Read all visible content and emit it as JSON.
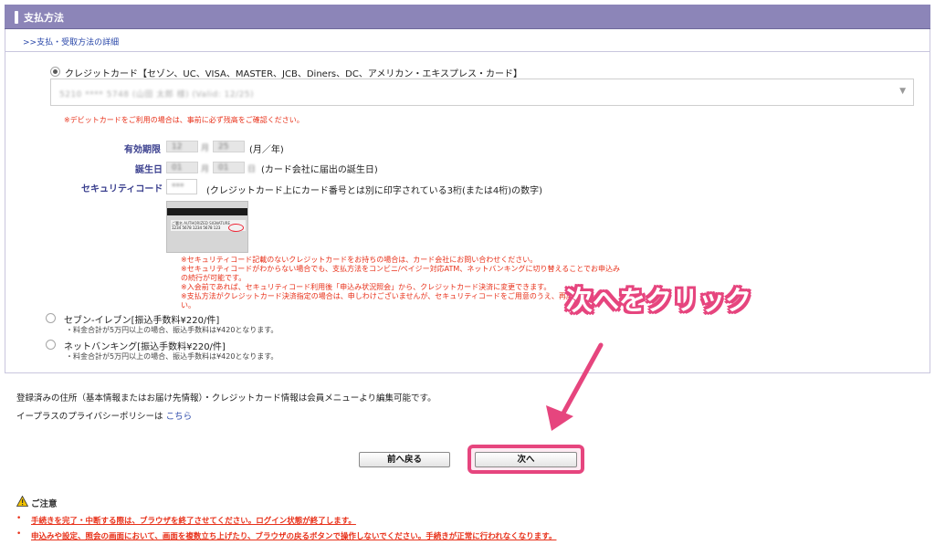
{
  "header": {
    "title": "支払方法"
  },
  "detail_link": ">>支払・受取方法の詳細",
  "credit": {
    "label": "クレジットカード【セゾン、UC、VISA、MASTER、JCB、Diners、DC、アメリカン・エキスプレス・カード】",
    "select_value": "5210 **** 5748 (山田 太郎 様) (Valid: 12/25)",
    "debit_note": "※デビットカードをご利用の場合は、事前に必ず残高をご確認ください。",
    "expiry_label": "有効期限",
    "expiry_month": "12",
    "expiry_month_unit": "月",
    "expiry_year": "25",
    "expiry_year_unit": "年",
    "expiry_note": "(月／年)",
    "birth_label": "誕生日",
    "birth_month": "01",
    "birth_month_unit": "月",
    "birth_day": "01",
    "birth_day_unit": "日",
    "birth_note": "(カード会社に届出の誕生日)",
    "security_label": "セキュリティコード",
    "security_value": "***",
    "security_note": "(クレジットカード上にカード番号とは別に印字されている3桁(または4桁)の数字)",
    "card_sig_text": "ご署名 AUTHORIZED SIGNATURE",
    "card_num_text": "1234 5678 1234 5678 123",
    "security_notes": [
      "※セキュリティコード記載のないクレジットカードをお持ちの場合は、カード会社にお問い合わせください。",
      "※セキュリティコードがわからない場合でも、支払方法をコンビニ/ペイジー対応ATM、ネットバンキングに切り替えることでお申込み",
      "の続行が可能です。",
      "※入会前であれば、セキュリティコード利用後「申込み状況照会」から、クレジットカード決済に変更できます。",
      "※支払方法がクレジットカード決済指定の場合は、申しわけございませんが、セキュリティコードをご用意のうえ、再度お",
      "い。"
    ]
  },
  "seven": {
    "label": "セブン-イレブン[振込手数料¥220/件]",
    "note": "・料金合計が5万円以上の場合、振込手数料は¥420となります。"
  },
  "netbank": {
    "label": "ネットバンキング[振込手数料¥220/件]",
    "note": "・料金合計が5万円以上の場合、振込手数料は¥420となります。"
  },
  "info": {
    "line1": "登録済みの住所（基本情報またはお届け先情報）・クレジットカード情報は会員メニューより編集可能です。",
    "line2_prefix": "イープラスのプライバシーポリシーは",
    "line2_link": "こちら"
  },
  "buttons": {
    "back": "前へ戻る",
    "next": "次へ"
  },
  "callout": "次へをクリック",
  "caution": {
    "title": "ご注意",
    "items": [
      "手続きを完了・中断する際は、ブラウザを終了させてください。ログイン状態が終了します。",
      "申込みや設定、照会の画面において、画面を複数立ち上げたり、ブラウザの戻るボタンで操作しないでください。手続きが正常に行われなくなります。"
    ]
  },
  "colors": {
    "header": "#8c85b8",
    "accent_pink": "#e6457e",
    "warning_red": "#e8311a",
    "label_blue": "#3a3f8e"
  }
}
